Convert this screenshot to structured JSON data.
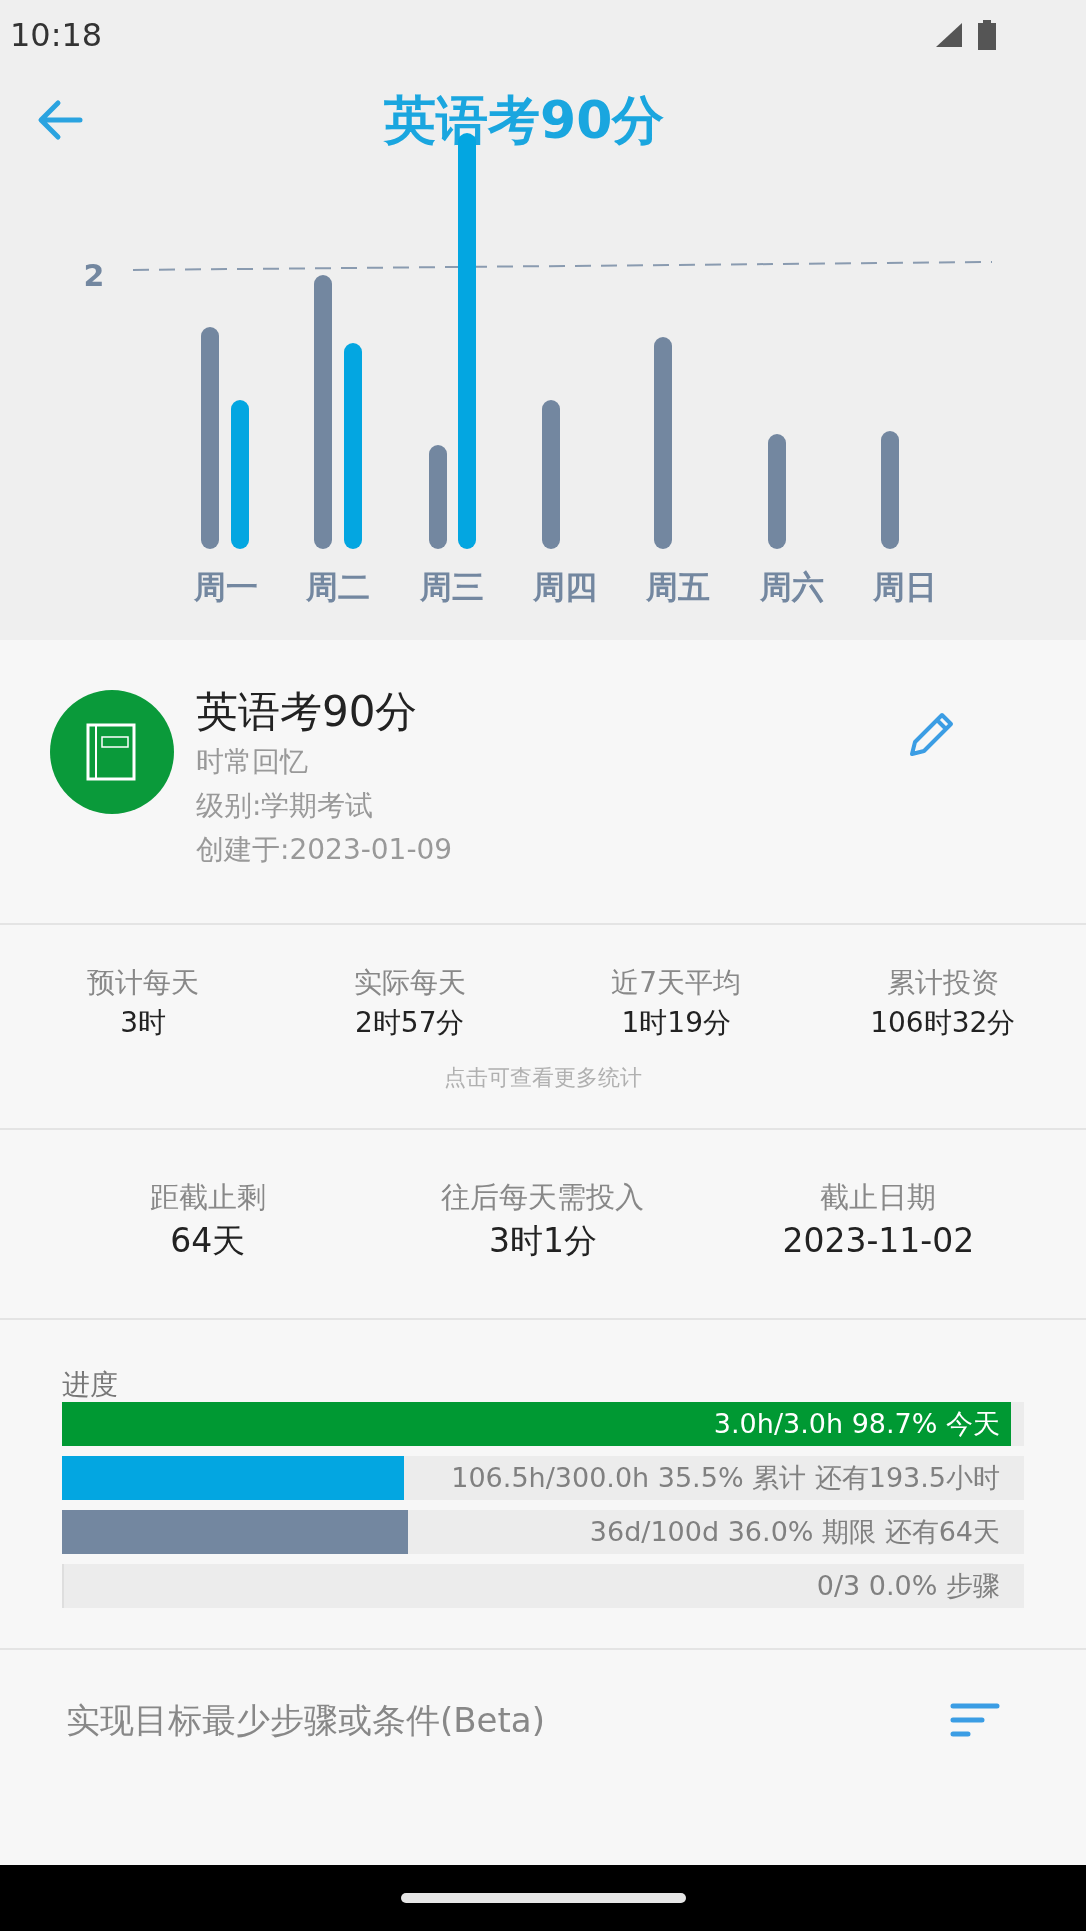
{
  "status_bar": {
    "time": "10:18"
  },
  "header": {
    "title": "英语考90分"
  },
  "weekly_chart": {
    "target_label": "2",
    "days": [
      "周一",
      "周二",
      "周三",
      "周四",
      "周五",
      "周六",
      "周日"
    ]
  },
  "goal": {
    "name": "英语考90分",
    "lines": [
      "时常回忆",
      "级别:学期考试",
      "创建于:2023-01-09"
    ]
  },
  "stats": [
    {
      "label": "预计每天",
      "value": "3时"
    },
    {
      "label": "实际每天",
      "value": "2时57分"
    },
    {
      "label": "近7天平均",
      "value": "1时19分"
    },
    {
      "label": "累计投资",
      "value": "106时32分"
    }
  ],
  "stats_hint": "点击可查看更多统计",
  "deadline": [
    {
      "label": "距截止剩",
      "value": "64天"
    },
    {
      "label": "往后每天需投入",
      "value": "3时1分"
    },
    {
      "label": "截止日期",
      "value": "2023-11-02"
    }
  ],
  "progress": {
    "title": "进度",
    "bars": [
      {
        "text": "3.0h/3.0h 98.7% 今天",
        "level": 0.987,
        "color": "#009933"
      },
      {
        "text": "106.5h/300.0h 35.5% 累计 还有193.5小时",
        "level": 0.355,
        "color": "#03a6e1"
      },
      {
        "text": "36d/100d 36.0% 期限 还有64天",
        "level": 0.36,
        "color": "#7387a0"
      },
      {
        "text": "0/3 0.0% 步骤",
        "level": 0.0
      }
    ]
  },
  "steps": {
    "title": "实现目标最少步骤或条件(Beta)"
  }
}
